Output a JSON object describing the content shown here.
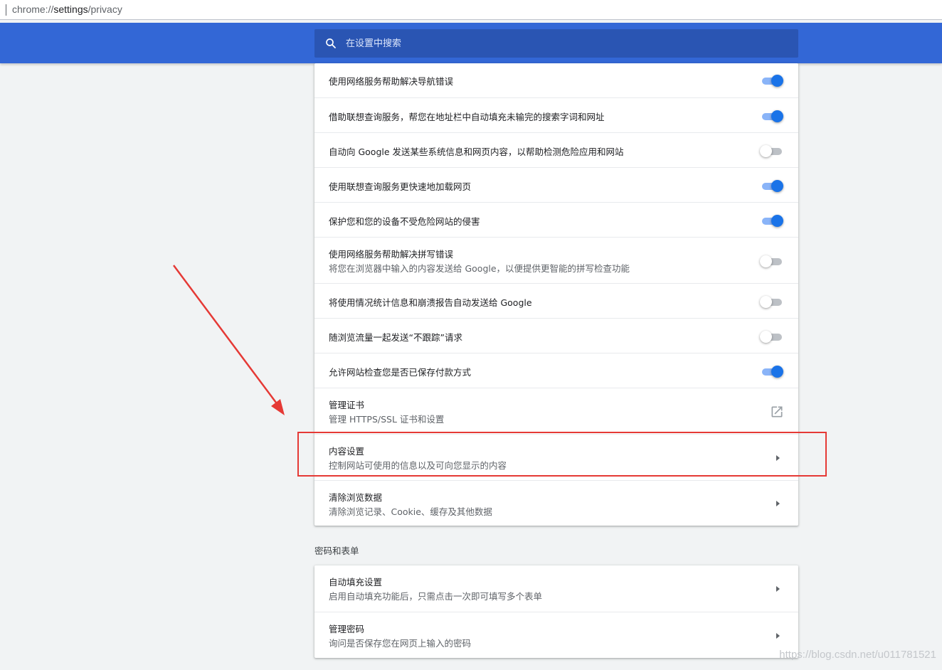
{
  "address_bar": {
    "scheme": "chrome://",
    "host": "settings",
    "path": "/privacy"
  },
  "header": {
    "search_placeholder": "在设置中搜索",
    "search_icon": "search-icon"
  },
  "privacy_card": {
    "rows": [
      {
        "label": "使用网络服务帮助解决导航错误",
        "control": "toggle",
        "state": "on"
      },
      {
        "label": "借助联想查询服务，帮您在地址栏中自动填充未输完的搜索字词和网址",
        "control": "toggle",
        "state": "on"
      },
      {
        "label": "自动向 Google 发送某些系统信息和网页内容，以帮助检测危险应用和网站",
        "control": "toggle",
        "state": "off"
      },
      {
        "label": "使用联想查询服务更快速地加载网页",
        "control": "toggle",
        "state": "on"
      },
      {
        "label": "保护您和您的设备不受危险网站的侵害",
        "control": "toggle",
        "state": "on"
      },
      {
        "label": "使用网络服务帮助解决拼写错误",
        "sublabel": "将您在浏览器中输入的内容发送给 Google，以便提供更智能的拼写检查功能",
        "control": "toggle",
        "state": "off"
      },
      {
        "label": "将使用情况统计信息和崩溃报告自动发送给 Google",
        "control": "toggle",
        "state": "off"
      },
      {
        "label": "随浏览流量一起发送“不跟踪”请求",
        "control": "toggle",
        "state": "off"
      },
      {
        "label": "允许网站检查您是否已保存付款方式",
        "control": "toggle",
        "state": "on"
      },
      {
        "label": "管理证书",
        "sublabel": "管理 HTTPS/SSL 证书和设置",
        "control": "external-link",
        "icon": "open-in-new-icon"
      },
      {
        "label": "内容设置",
        "sublabel": "控制网站可使用的信息以及可向您显示的内容",
        "control": "arrow",
        "icon": "arrow-right-icon",
        "highlighted": true
      },
      {
        "label": "清除浏览数据",
        "sublabel": "清除浏览记录、Cookie、缓存及其他数据",
        "control": "arrow",
        "icon": "arrow-right-icon"
      }
    ]
  },
  "passwords_section": {
    "title": "密码和表单",
    "rows": [
      {
        "label": "自动填充设置",
        "sublabel": "启用自动填充功能后，只需点击一次即可填写多个表单",
        "control": "arrow",
        "icon": "arrow-right-icon"
      },
      {
        "label": "管理密码",
        "sublabel": "询问是否保存您在网页上输入的密码",
        "control": "arrow",
        "icon": "arrow-right-icon"
      }
    ]
  },
  "annotation": {
    "highlight_color": "#e53935",
    "arrow_color": "#e53935"
  },
  "colors": {
    "header_blue": "#3367d6",
    "search_bg": "#2a55b3",
    "toggle_on": "#1a73e8",
    "toggle_on_track": "#8ab4f8",
    "toggle_off_track": "#bdc1c6"
  },
  "watermark": "https://blog.csdn.net/u011781521"
}
